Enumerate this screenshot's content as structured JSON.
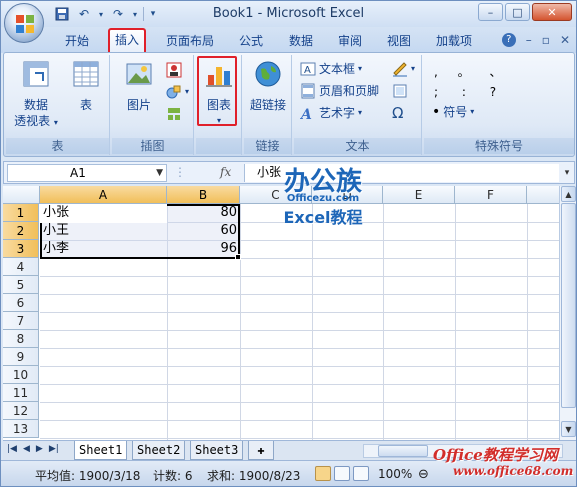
{
  "window": {
    "title": "Book1 - Microsoft Excel",
    "controls": [
      "–",
      "□",
      "✕"
    ]
  },
  "tabs": [
    "开始",
    "插入",
    "页面布局",
    "公式",
    "数据",
    "审阅",
    "视图",
    "加载项"
  ],
  "active_tab": "插入",
  "ribbon": {
    "groups": {
      "table": {
        "label": "表",
        "pivot_line1": "数据",
        "pivot_line2": "透视表",
        "table_btn": "表"
      },
      "illustrations": {
        "label": "插图",
        "picture_btn": "图片"
      },
      "charts": {
        "chart_btn": "图表"
      },
      "links": {
        "label": "链接",
        "hyperlink_btn": "超链接"
      },
      "text": {
        "label": "文本",
        "textbox_btn": "文本框",
        "header_footer_btn": "页眉和页脚",
        "wordart_btn": "艺术字"
      },
      "special_symbols": {
        "label": "特殊符号",
        "symbols_row1": ", 。 、",
        "symbols_row2": "; : ?",
        "symbol_btn": "符号"
      }
    }
  },
  "formula_bar": {
    "name_box": "A1",
    "fx": "fx",
    "content": "小张"
  },
  "columns": [
    "A",
    "B",
    "C",
    "D",
    "E",
    "F"
  ],
  "rows": [
    "1",
    "2",
    "3",
    "4",
    "5",
    "6",
    "7",
    "8",
    "9",
    "10",
    "11",
    "12",
    "13"
  ],
  "cells": [
    {
      "name": "小张",
      "value": "80"
    },
    {
      "name": "小王",
      "value": "60"
    },
    {
      "name": "小李",
      "value": "96"
    }
  ],
  "sheets": [
    "Sheet1",
    "Sheet2",
    "Sheet3"
  ],
  "active_sheet": "Sheet1",
  "status": {
    "average": "平均值: 1900/3/18",
    "count": "计数: 6",
    "sum": "求和: 1900/8/23",
    "zoom": "100%"
  },
  "watermarks": {
    "top_brand": "办公族",
    "top_url": "Officezu.com",
    "top_caption": "Excel教程",
    "bottom_brand": "Office教程学习网",
    "bottom_url": "www.office68.com"
  }
}
